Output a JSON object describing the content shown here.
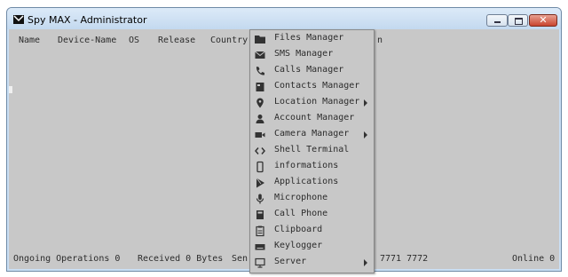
{
  "window": {
    "title": "Spy MAX - Administrator"
  },
  "columns": [
    "Name",
    "Device-Name",
    "OS",
    "Release",
    "Country",
    "n"
  ],
  "status": {
    "ongoing": "Ongoing Operations 0",
    "received": "Received 0 Bytes",
    "sent": "Sen",
    "ports": "7771 7772",
    "online": "Online 0"
  },
  "menu": [
    {
      "label": "Files Manager",
      "icon": "folder-icon",
      "submenu": false
    },
    {
      "label": "SMS Manager",
      "icon": "envelope-icon",
      "submenu": false
    },
    {
      "label": "Calls Manager",
      "icon": "phone-icon",
      "submenu": false
    },
    {
      "label": "Contacts Manager",
      "icon": "contacts-icon",
      "submenu": false
    },
    {
      "label": "Location Manager",
      "icon": "map-pin-icon",
      "submenu": true
    },
    {
      "label": "Account Manager",
      "icon": "user-icon",
      "submenu": false
    },
    {
      "label": "Camera Manager",
      "icon": "video-camera-icon",
      "submenu": true
    },
    {
      "label": "Shell Terminal",
      "icon": "code-icon",
      "submenu": false
    },
    {
      "label": "informations",
      "icon": "mobile-icon",
      "submenu": false
    },
    {
      "label": "Applications",
      "icon": "play-store-icon",
      "submenu": false
    },
    {
      "label": "Microphone",
      "icon": "microphone-icon",
      "submenu": false
    },
    {
      "label": "Call Phone",
      "icon": "dialpad-icon",
      "submenu": false
    },
    {
      "label": "Clipboard",
      "icon": "clipboard-icon",
      "submenu": false
    },
    {
      "label": "Keylogger",
      "icon": "keyboard-icon",
      "submenu": false
    },
    {
      "label": "Server",
      "icon": "monitor-icon",
      "submenu": true
    }
  ]
}
